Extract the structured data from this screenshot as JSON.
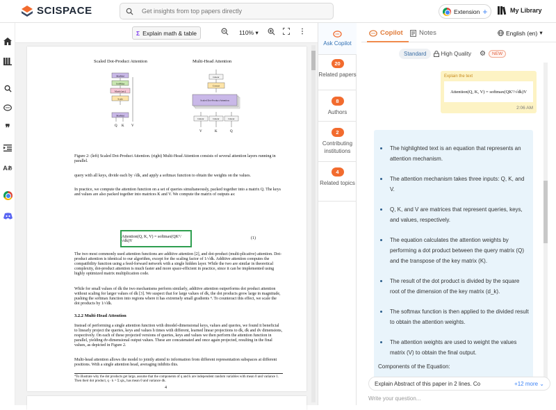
{
  "header": {
    "logo_text": "SCISPACE",
    "search_placeholder": "Get insights from top papers directly",
    "extension_label": "Extension",
    "library_label": "My Library"
  },
  "left_rail": {
    "icons": [
      "home-icon",
      "library-icon",
      "search-icon",
      "chat-icon",
      "quote-icon",
      "list-indent-icon",
      "translate-icon",
      "chrome-icon",
      "discord-icon"
    ]
  },
  "viewer": {
    "explain_label": "Explain math & table",
    "zoom_level": "110%",
    "page_number": "4",
    "fig_left_title": "Scaled Dot-Product Attention",
    "fig_right_title": "Multi-Head Attention",
    "fig_left_boxes": [
      "MatMul",
      "SoftMax",
      "Mask (opt.)",
      "Scale",
      "MatMul"
    ],
    "fig_right_boxes": [
      "Linear",
      "Concat",
      "Scaled Dot-Product Attention",
      "Linear",
      "Linear",
      "Linear"
    ],
    "qkv": [
      "Q",
      "K",
      "V"
    ],
    "caption": "Figure 2: (left) Scaled Dot-Product Attention. (right) Multi-Head Attention consists of several attention layers running in parallel.",
    "para1": "query with all keys, divide each by √dk, and apply a softmax function to obtain the weights on the values.",
    "para2": "In practice, we compute the attention function on a set of queries simultaneously, packed together into a matrix Q. The keys and values are also packed together into matrices K and V. We compute the matrix of outputs as:",
    "equation": "Attention(Q, K, V) = softmax(QKᵀ/√dk)V",
    "eq_number": "(1)",
    "para3": "The two most commonly used attention functions are additive attention [2], and dot-product (multi-plicative) attention. Dot-product attention is identical to our algorithm, except for the scaling factor of 1/√dk. Additive attention computes the compatibility function using a feed-forward network with a single hidden layer. While the two are similar in theoretical complexity, dot-product attention is much faster and more space-efficient in practice, since it can be implemented using highly optimized matrix multiplication code.",
    "para4": "While for small values of dk the two mechanisms perform similarly, additive attention outperforms dot product attention without scaling for larger values of dk [3]. We suspect that for large values of dk, the dot products grow large in magnitude, pushing the softmax function into regions where it has extremely small gradients ⁴. To counteract this effect, we scale the dot products by 1/√dk.",
    "section": "3.2.2   Multi-Head Attention",
    "para5": "Instead of performing a single attention function with dmodel-dimensional keys, values and queries, we found it beneficial to linearly project the queries, keys and values h times with different, learned linear projections to dk, dk and dv dimensions, respectively. On each of these projected versions of queries, keys and values we then perform the attention function in parallel, yielding dv-dimensional output values. These are concatenated and once again projected, resulting in the final values, as depicted in Figure 2.",
    "para6": "Multi-head attention allows the model to jointly attend to information from different representation subspaces at different positions. With a single attention head, averaging inhibits this.",
    "footnote": "⁴To illustrate why the dot products get large, assume that the components of q and k are independent random variables with mean 0 and variance 1. Then their dot product, q · k = Σ qᵢkᵢ, has mean 0 and variance dk."
  },
  "side_panel": {
    "ask_copilot": "Ask Copilot",
    "items": [
      {
        "count": "20",
        "label": "Related papers"
      },
      {
        "count": "8",
        "label": "Authors"
      },
      {
        "count": "2",
        "label": "Contributing institutions"
      },
      {
        "count": "4",
        "label": "Related topics"
      }
    ]
  },
  "copilot": {
    "tab_copilot": "Copilot",
    "tab_notes": "Notes",
    "language": "English (en)",
    "mode_standard": "Standard",
    "mode_hq": "High Quality",
    "new_badge": "NEW",
    "user_label": "Explain the text",
    "user_equation": "Attention(Q, K, V) = softmax(QKᵀ/√dk)V",
    "user_time": "2:06 AM",
    "answer_points": [
      "The highlighted text is an equation that represents an attention mechanism.",
      "The attention mechanism takes three inputs: Q, K, and V.",
      "Q, K, and V are matrices that represent queries, keys, and values, respectively.",
      "The equation calculates the attention weights by performing a dot product between the query matrix (Q) and the transpose of the key matrix (K).",
      "The result of the dot product is divided by the square root of the dimension of the key matrix (d_k).",
      "The softmax function is then applied to the divided result to obtain the attention weights.",
      "The attention weights are used to weight the values matrix (V) to obtain the final output."
    ],
    "components_heading": "Components of the Equation:",
    "suggestion": "Explain Abstract of this paper in 2 lines. Co",
    "suggestion_more": "+12 more",
    "input_placeholder": "Write your question..."
  },
  "colors": {
    "accent": "#f26b2e",
    "equation_box": "#2e9e4f",
    "answer_bg": "#e9f4fb",
    "user_bg": "#fdf3c4"
  }
}
